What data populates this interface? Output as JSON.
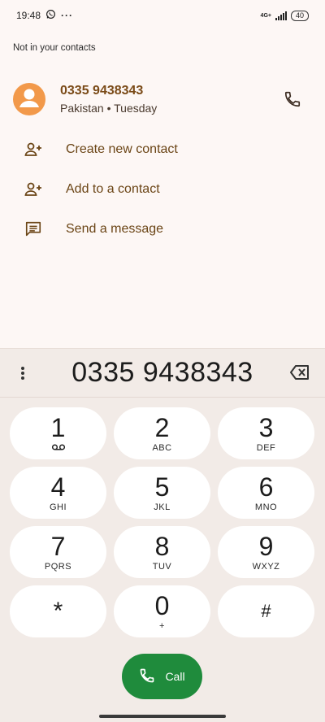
{
  "status_bar": {
    "time": "19:48",
    "network": "4G+",
    "battery": "40",
    "overflow": "···"
  },
  "caller": {
    "not_in_contacts": "Not in your contacts",
    "number": "0335 9438343",
    "location_day": "Pakistan • Tuesday"
  },
  "actions": [
    {
      "label": "Create new contact",
      "icon": "add-person-icon"
    },
    {
      "label": "Add to a contact",
      "icon": "add-person-icon"
    },
    {
      "label": "Send a message",
      "icon": "message-icon"
    }
  ],
  "dialpad": {
    "entered_number": "0335 9438343",
    "keys": [
      {
        "digit": "1",
        "letters": ""
      },
      {
        "digit": "2",
        "letters": "ABC"
      },
      {
        "digit": "3",
        "letters": "DEF"
      },
      {
        "digit": "4",
        "letters": "GHI"
      },
      {
        "digit": "5",
        "letters": "JKL"
      },
      {
        "digit": "6",
        "letters": "MNO"
      },
      {
        "digit": "7",
        "letters": "PQRS"
      },
      {
        "digit": "8",
        "letters": "TUV"
      },
      {
        "digit": "9",
        "letters": "WXYZ"
      },
      {
        "digit": "*",
        "letters": ""
      },
      {
        "digit": "0",
        "letters": "+"
      },
      {
        "digit": "#",
        "letters": ""
      }
    ],
    "call_label": "Call"
  },
  "colors": {
    "accent_brown": "#7a4a17",
    "avatar_orange": "#f2994a",
    "call_green": "#1f8b3c",
    "dialpad_bg": "#f2ebe7"
  }
}
